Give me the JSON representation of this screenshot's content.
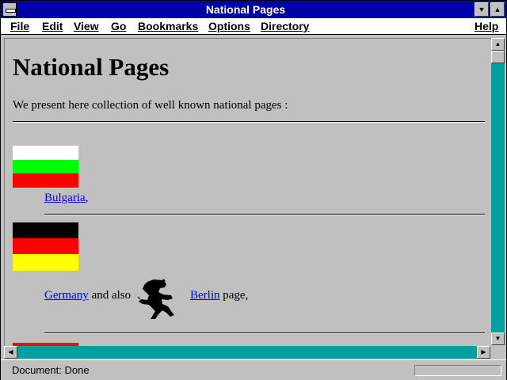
{
  "window": {
    "title": "National Pages"
  },
  "menus": [
    {
      "label": "File"
    },
    {
      "label": "Edit"
    },
    {
      "label": "View"
    },
    {
      "label": "Go"
    },
    {
      "label": "Bookmarks"
    },
    {
      "label": "Options"
    },
    {
      "label": "Directory"
    },
    {
      "label": "Help"
    }
  ],
  "page": {
    "heading": "National Pages",
    "intro": "We present here collection of well known national pages :",
    "bulgaria": {
      "link": "Bulgaria",
      "suffix": ","
    },
    "germany": {
      "link": "Germany",
      "middle": "and also",
      "berlin_link": "Berlin",
      "suffix": "page,"
    }
  },
  "flags": {
    "bulgaria": [
      "#ffffff",
      "#00ff00",
      "#ff0000"
    ],
    "germany": [
      "#000000",
      "#ff0000",
      "#ffff00"
    ]
  },
  "status": {
    "text": "Document: Done"
  },
  "colors": {
    "titlebar": "#0000a8",
    "scrollbar_track": "#00a0a0",
    "link": "#0000ee",
    "background": "#c0c0c0"
  },
  "icons": [
    "system-menu-icon",
    "minimize-icon",
    "maximize-icon",
    "berlin-bear-icon",
    "arrow-up-icon",
    "arrow-down-icon",
    "arrow-left-icon",
    "arrow-right-icon"
  ]
}
